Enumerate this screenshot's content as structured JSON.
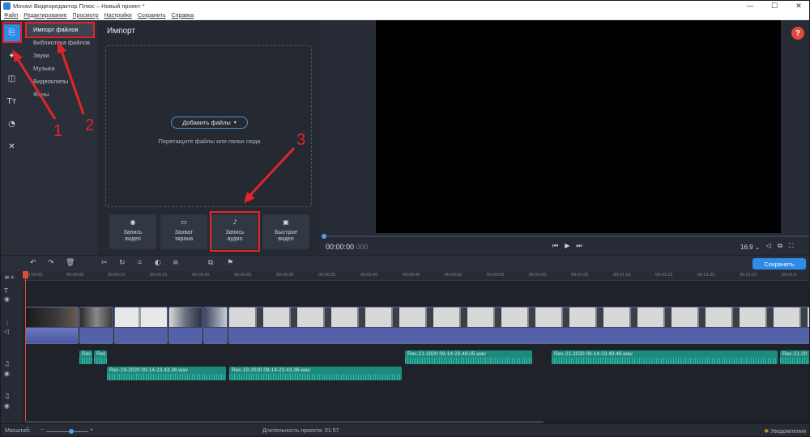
{
  "window": {
    "title": "Movavi Видеоредактор Плюс – Новый проект *"
  },
  "menu": {
    "items": [
      "Файл",
      "Редактирование",
      "Просмотр",
      "Настройки",
      "Сохранить",
      "Справка"
    ]
  },
  "sidebar": {
    "rail_icons": [
      "import-icon",
      "magic-wand-icon",
      "transitions-icon",
      "titles-icon",
      "stickers-icon",
      "tools-icon"
    ],
    "categories": [
      "Импорт файлов",
      "Библиотека файлов",
      "Звуки",
      "Музыка",
      "Видеоклипы",
      "Фоны"
    ],
    "active_category": "Импорт файлов"
  },
  "import_panel": {
    "title": "Импорт",
    "add_files_label": "Добавить файлы",
    "drop_hint": "Перетащите файлы или папки сюда",
    "capture_buttons": [
      {
        "line1": "Запись",
        "line2": "видео",
        "icon": "webcam-icon"
      },
      {
        "line1": "Захват",
        "line2": "экрана",
        "icon": "screen-icon"
      },
      {
        "line1": "Запись",
        "line2": "аудио",
        "icon": "microphone-icon"
      },
      {
        "line1": "Быстрое",
        "line2": "видео",
        "icon": "quick-video-icon"
      }
    ]
  },
  "preview": {
    "time_main": "00:00:00",
    "time_ms": "000",
    "aspect_ratio": "16:9 ⌄",
    "help_label": "?"
  },
  "toolbar": {
    "save_label": "Сохранить"
  },
  "timeline": {
    "ticks": [
      "00:00:00",
      "00:00:05",
      "00:00:10",
      "00:00:15",
      "00:00:20",
      "00:00:25",
      "00:00:30",
      "00:00:35",
      "00:00:40",
      "00:00:45",
      "00:00:50",
      "00:00:55",
      "00:01:00",
      "00:01:05",
      "00:01:10",
      "00:01:15",
      "00:01:20",
      "00:01:25",
      "00:01:3"
    ],
    "audio_clips": [
      {
        "label": "Rec"
      },
      {
        "label": "Rec"
      },
      {
        "label": "Rec-19-2020 09-14-23.43.36.wav"
      },
      {
        "label": "Rec-19-2020 09-14-23.43.36.wav"
      },
      {
        "label": "Rec-21-2020 09-14-23.48.05.wav"
      },
      {
        "label": "Rec-21-2020 09-14-23.49.46.wav"
      },
      {
        "label": "Rec-21-20"
      }
    ]
  },
  "statusbar": {
    "zoom_label": "Масштаб:",
    "duration": "Длительность проекта: 01:57",
    "notifications": "Уведомления"
  },
  "annotations": {
    "numbers": [
      "1",
      "2",
      "3"
    ]
  }
}
